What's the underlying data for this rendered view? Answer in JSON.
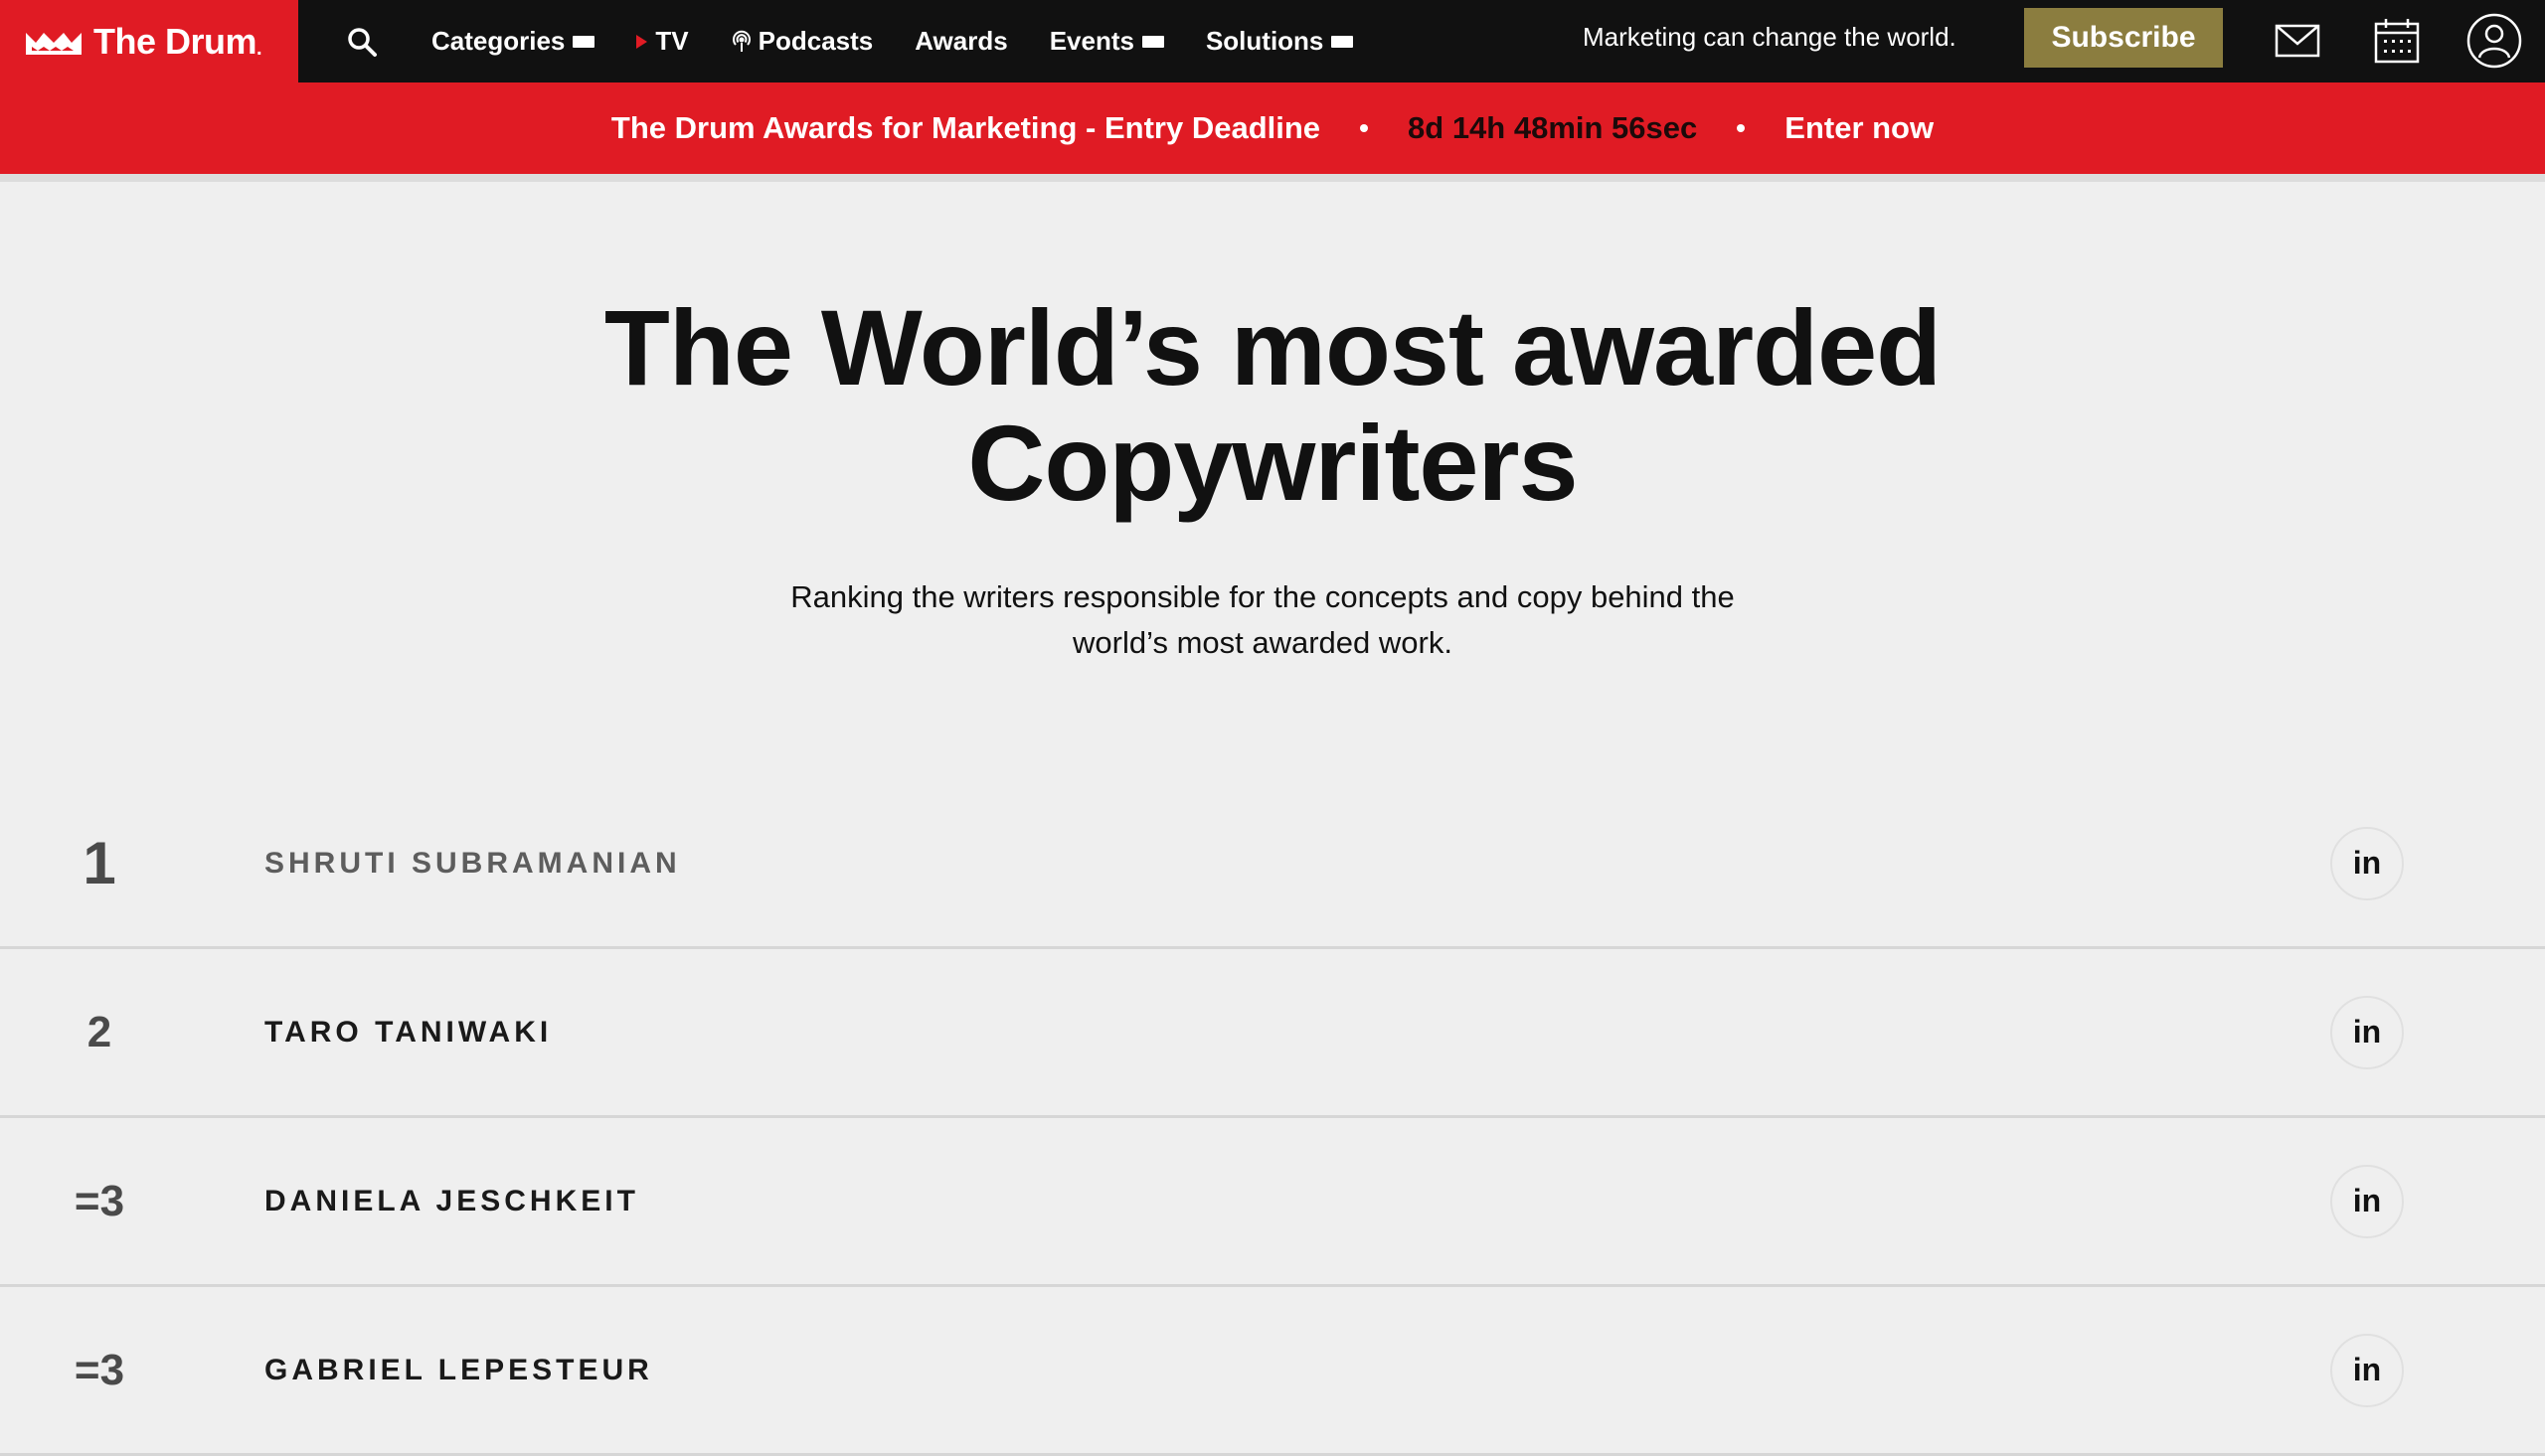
{
  "header": {
    "logo_text": "The Drum",
    "logo_dot": ".",
    "nav": [
      {
        "label": "Categories",
        "has_dropdown": true
      },
      {
        "label": "TV",
        "icon": "play-icon"
      },
      {
        "label": "Podcasts",
        "icon": "podcast-icon"
      },
      {
        "label": "Awards"
      },
      {
        "label": "Events",
        "has_dropdown": true
      },
      {
        "label": "Solutions",
        "has_dropdown": true
      }
    ],
    "tagline": "Marketing can change the world.",
    "subscribe_label": "Subscribe",
    "icons": [
      "search-icon",
      "mail-icon",
      "calendar-icon",
      "user-icon"
    ]
  },
  "banner": {
    "text": "The Drum Awards for Marketing - Entry Deadline",
    "countdown": "8d 14h 48min 56sec",
    "cta": "Enter now"
  },
  "hero": {
    "title_line1": "The World’s most awarded",
    "title_line2": "Copywriters",
    "subtitle_line1": "Ranking the writers responsible for the concepts and copy behind the",
    "subtitle_line2": "world’s most awarded work."
  },
  "rankings": [
    {
      "rank": "1",
      "name": "Shruti Subramanian",
      "social": "in"
    },
    {
      "rank": "2",
      "name": "Taro Taniwaki",
      "social": "in"
    },
    {
      "rank": "=3",
      "name": "Daniela Jeschkeit",
      "social": "in"
    },
    {
      "rank": "=3",
      "name": "Gabriel Lepesteur",
      "social": "in"
    }
  ],
  "colors": {
    "brand_red": "#e01b24",
    "nav_bg": "#111111",
    "subscribe_gold": "#8b7d3f",
    "page_bg": "#efefef"
  }
}
